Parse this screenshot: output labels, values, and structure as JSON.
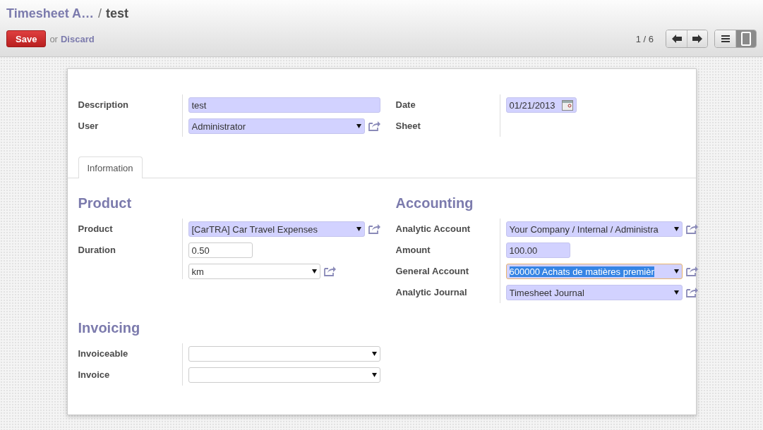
{
  "breadcrumb": {
    "parent": "Timesheet A…",
    "separator": "/",
    "current": "test"
  },
  "actions": {
    "save": "Save",
    "or": "or",
    "discard": "Discard"
  },
  "pager": "1 / 6",
  "views": [
    {
      "kind": "list",
      "selected": false
    },
    {
      "kind": "form",
      "selected": true
    }
  ],
  "header_groups": [
    {
      "fields": [
        {
          "label": "Description",
          "widgets": [
            {
              "kind": "input",
              "value": "test",
              "required": true,
              "link": false
            }
          ]
        },
        {
          "label": "User",
          "widgets": [
            {
              "kind": "select",
              "value": "Administrator",
              "required": true,
              "link": true
            }
          ]
        }
      ]
    },
    {
      "fields": [
        {
          "label": "Date",
          "widgets": [
            {
              "kind": "date",
              "value": "01/21/2013",
              "required": true,
              "link": false
            }
          ]
        },
        {
          "label": "Sheet"
        }
      ]
    }
  ],
  "tabs": [
    {
      "label": "Information",
      "selected": true
    }
  ],
  "sections": [
    {
      "title": "Product",
      "fields": [
        {
          "label": "Product",
          "widgets": [
            {
              "kind": "select",
              "value": "[CarTRA] Car Travel Expenses",
              "required": true,
              "link": true
            }
          ]
        },
        {
          "label": "Duration",
          "widgets": [
            {
              "kind": "number",
              "value": "0.50",
              "required": false,
              "link": false
            },
            {
              "kind": "unit_select",
              "value": "km",
              "required": false,
              "link": true
            }
          ]
        }
      ]
    },
    {
      "title": "Accounting",
      "fields": [
        {
          "label": "Analytic Account",
          "widgets": [
            {
              "kind": "select",
              "value": "Your Company / Internal / Administra",
              "required": true,
              "link": true
            }
          ]
        },
        {
          "label": "Amount",
          "widgets": [
            {
              "kind": "number",
              "value": "100.00",
              "required": true,
              "link": false
            }
          ]
        },
        {
          "label": "General Account",
          "widgets": [
            {
              "kind": "select",
              "value": "600000 Achats de matières premièr",
              "required": true,
              "link": true,
              "text_selected": true
            }
          ]
        },
        {
          "label": "Analytic Journal",
          "widgets": [
            {
              "kind": "select",
              "value": "Timesheet Journal",
              "required": true,
              "link": true
            }
          ]
        }
      ]
    },
    {
      "title": "Invoicing",
      "fields": [
        {
          "label": "Invoiceable",
          "widgets": [
            {
              "kind": "select",
              "required": false,
              "link": false
            }
          ]
        },
        {
          "label": "Invoice",
          "widgets": [
            {
              "kind": "select",
              "required": false,
              "link": false
            }
          ]
        }
      ]
    }
  ]
}
